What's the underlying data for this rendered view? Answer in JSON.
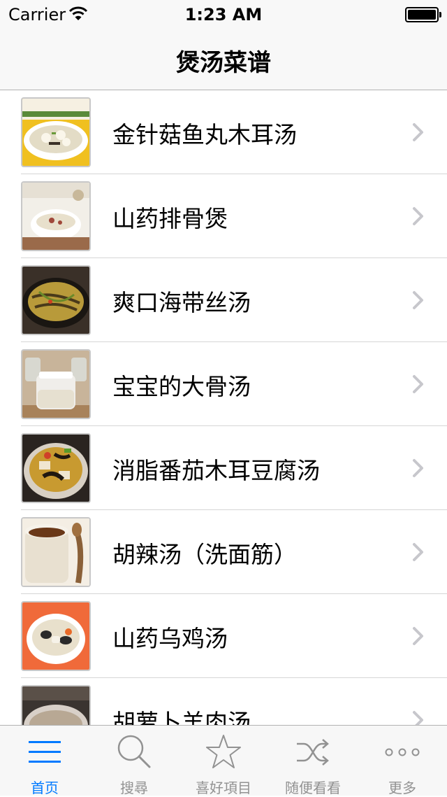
{
  "status_bar": {
    "carrier": "Carrier",
    "time": "1:23 AM"
  },
  "nav": {
    "title": "煲汤菜谱"
  },
  "recipes": [
    {
      "name": "金针菇鱼丸木耳汤"
    },
    {
      "name": "山药排骨煲"
    },
    {
      "name": "爽口海带丝汤"
    },
    {
      "name": "宝宝的大骨汤"
    },
    {
      "name": "消脂番茄木耳豆腐汤"
    },
    {
      "name": "胡辣汤（洗面筋）"
    },
    {
      "name": "山药乌鸡汤"
    },
    {
      "name": "胡萝卜羊肉汤"
    }
  ],
  "tabs": [
    {
      "label": "首页",
      "icon": "list-icon",
      "active": true
    },
    {
      "label": "搜尋",
      "icon": "search-icon"
    },
    {
      "label": "喜好項目",
      "icon": "star-icon"
    },
    {
      "label": "随便看看",
      "icon": "shuffle-icon"
    },
    {
      "label": "更多",
      "icon": "more-icon"
    }
  ],
  "colors": {
    "accent": "#007aff",
    "tab_inactive": "#929292",
    "chevron": "#c7c7cc",
    "separator": "#d6d6d6"
  }
}
